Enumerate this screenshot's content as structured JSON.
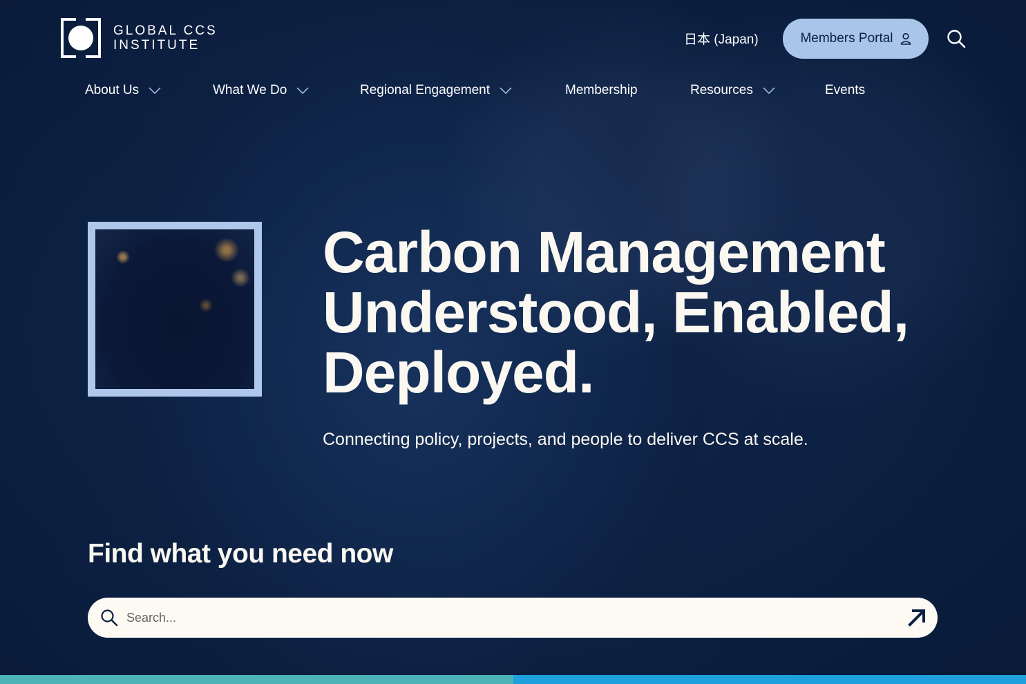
{
  "header": {
    "logo_line1": "GLOBAL CCS",
    "logo_line2": "INSTITUTE",
    "language": "日本 (Japan)",
    "members_portal": "Members Portal"
  },
  "nav": {
    "items": [
      {
        "label": "About Us",
        "has_dropdown": true
      },
      {
        "label": "What We Do",
        "has_dropdown": true
      },
      {
        "label": "Regional Engagement",
        "has_dropdown": true
      },
      {
        "label": "Membership",
        "has_dropdown": false
      },
      {
        "label": "Resources",
        "has_dropdown": true
      },
      {
        "label": "Events",
        "has_dropdown": false
      }
    ]
  },
  "hero": {
    "headline_line1": "Carbon Management",
    "headline_line2": "Understood, Enabled,",
    "headline_line3": "Deployed.",
    "subheadline": "Connecting policy, projects, and people to deliver CCS at scale."
  },
  "find": {
    "title": "Find what you need now",
    "search_placeholder": "Search..."
  },
  "colors": {
    "background": "#0b1e3f",
    "portal_button": "#a9c6ea",
    "frame": "#aec7ea",
    "search_bar": "#fcfaf3",
    "strip_left": "#4db3b8",
    "strip_right": "#1ea0dc"
  },
  "icons": {
    "search": "search-icon",
    "user": "user-icon",
    "chevron": "chevron-down-icon",
    "arrow": "arrow-up-right-icon"
  }
}
